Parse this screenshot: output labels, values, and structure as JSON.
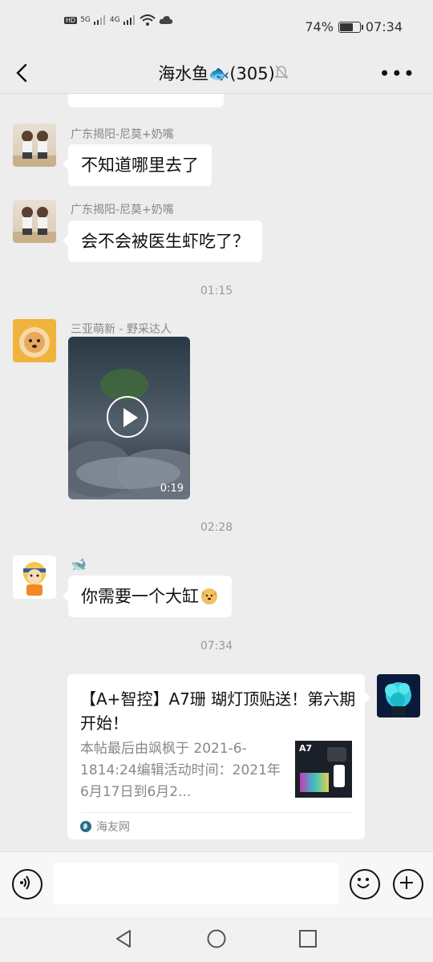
{
  "status_bar": {
    "left_labels": [
      "HD",
      "5G",
      "4G"
    ],
    "battery": "74%",
    "battery_level": 0.74,
    "time": "07:34"
  },
  "header": {
    "title": "海水鱼🐟(305)",
    "icons": [
      "back-arrow-icon",
      "mute-bell-icon",
      "more-icon"
    ]
  },
  "messages": [
    {
      "sender": "广东揭阳-尼莫+奶嘴",
      "text": "不知道哪里去了"
    },
    {
      "sender": "广东揭阳-尼莫+奶嘴",
      "text": "会不会被医生虾吃了？"
    },
    {
      "time": "01:15"
    },
    {
      "sender": "三亚萌新 - 野采达人",
      "video_duration": "0:19"
    },
    {
      "time": "02:28"
    },
    {
      "sender": "🐋",
      "text": "你需要一个大缸"
    },
    {
      "time": "07:34"
    },
    {
      "card": {
        "title": "【A+智控】A7珊 瑚灯顶贴送！第六期开始！",
        "desc": "本帖最后由飒枫于 2021-6-1814:24编辑活动时间：2021年6月17日到6月2...",
        "thumb_label": "A7",
        "source": "海友网"
      }
    }
  ],
  "colors": {
    "background": "#ededed",
    "bubble": "#ffffff",
    "time": "#999999",
    "sender": "#888888"
  },
  "input_bar": {
    "icons": [
      "voice-icon",
      "emoji-icon",
      "plus-icon"
    ]
  },
  "nav_bar": {
    "icons": [
      "back-triangle-icon",
      "home-circle-icon",
      "recent-square-icon"
    ]
  }
}
